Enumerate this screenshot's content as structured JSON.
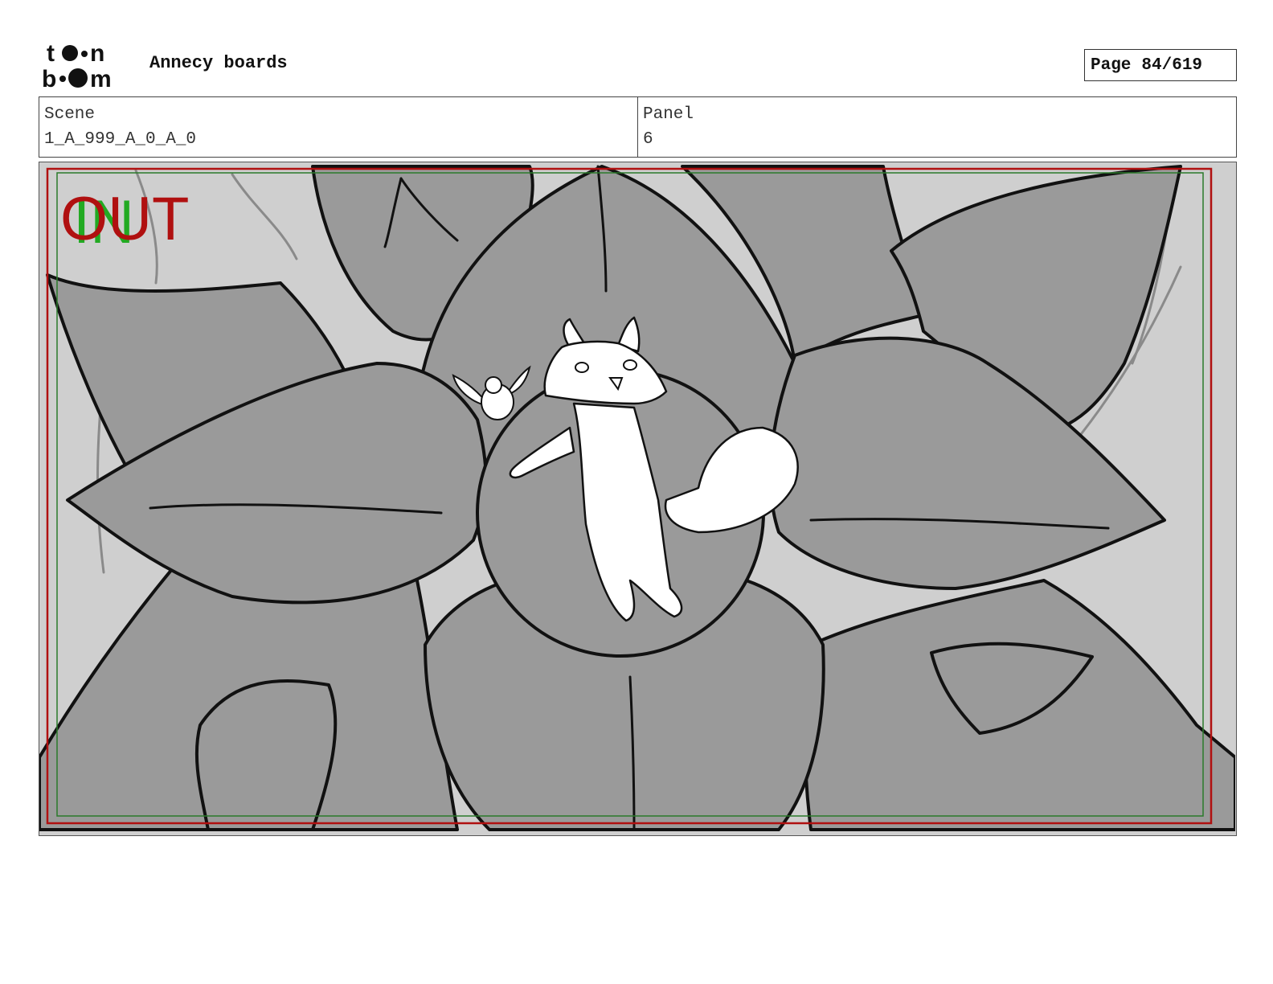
{
  "header": {
    "logo_text": "toon boom",
    "title": "Annecy boards",
    "page_label": "Page",
    "page_number": "84/619"
  },
  "info": {
    "scene_label": "Scene",
    "scene_value": "1_A_999_A_0_A_0",
    "panel_label": "Panel",
    "panel_value": "6"
  },
  "panel": {
    "in_mark": "IN",
    "out_mark": "OUT"
  },
  "colors": {
    "petal": "#9a9a9a",
    "background": "#cfcfcf",
    "out_red": "#b01010",
    "in_green": "#22aa22",
    "safe_frame_green": "#2a7a2a"
  }
}
